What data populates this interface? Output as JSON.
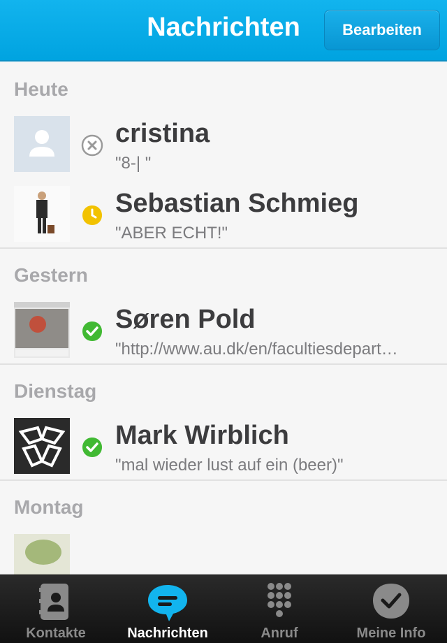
{
  "header": {
    "title": "Nachrichten",
    "edit_label": "Bearbeiten"
  },
  "sections": [
    {
      "label": "Heute",
      "rows": [
        {
          "name": "cristina",
          "message": "\"8-| \"",
          "status": "offline"
        },
        {
          "name": "Sebastian Schmieg",
          "message": "\"ABER ECHT!\"",
          "status": "away"
        }
      ]
    },
    {
      "label": "Gestern",
      "rows": [
        {
          "name": "Søren Pold",
          "message": "\"http://www.au.dk/en/facultiesdepart…",
          "status": "online"
        }
      ]
    },
    {
      "label": "Dienstag",
      "rows": [
        {
          "name": "Mark Wirblich",
          "message": "\"mal wieder lust auf ein  (beer)\"",
          "status": "online"
        }
      ]
    },
    {
      "label": "Montag",
      "rows": []
    }
  ],
  "tabs": [
    {
      "label": "Kontakte",
      "icon": "contacts-icon",
      "active": false
    },
    {
      "label": "Nachrichten",
      "icon": "chat-bubble-icon",
      "active": true
    },
    {
      "label": "Anruf",
      "icon": "dialpad-icon",
      "active": false
    },
    {
      "label": "Meine Info",
      "icon": "my-info-icon",
      "active": false
    }
  ],
  "colors": {
    "accent": "#00a3e0",
    "online": "#41b933",
    "away": "#f2c200"
  }
}
